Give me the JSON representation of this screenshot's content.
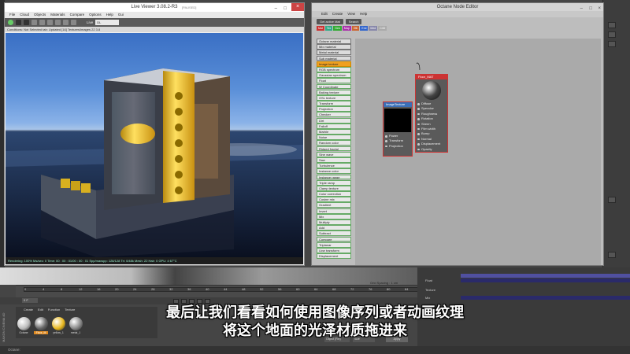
{
  "live_viewer": {
    "title": "Live Viewer 3.08.2-R3",
    "subtitle": "[PAUSED]",
    "menu": [
      "File",
      "Cloud",
      "Objects",
      "Materials",
      "Compare",
      "Options",
      "Help",
      "Gui"
    ],
    "toolbar_label": "Live",
    "toolbar_select": "DL",
    "status": "Conditions: Not Selected tab: Updated [16] Textures/images 22 3.8",
    "footer": "Rendering: 100%  Ms/sec: 0   Time: 00 : 00 : 01/00 : 00 : 01   Spp/maxspp: 128/128   Tri: 0/48k   Mesh: 22   Hair: 0   GPU: 4   67°C"
  },
  "node_editor": {
    "title": "Octane Node Editor",
    "menu": [
      "Edit",
      "Create",
      "View",
      "Help"
    ],
    "toolbar": [
      "Get active Mat",
      "Search"
    ],
    "tabs": [
      {
        "label": "Mat",
        "color": "#c33"
      },
      {
        "label": "Tex",
        "color": "#3a8"
      },
      {
        "label": "Gen",
        "color": "#3a3"
      },
      {
        "label": "Map",
        "color": "#a3a"
      },
      {
        "label": "Oth",
        "color": "#c63"
      },
      {
        "label": "Emi",
        "color": "#36c"
      },
      {
        "label": "Med",
        "color": "#88a"
      },
      {
        "label": "C4D",
        "color": "#aaa"
      }
    ],
    "node_list": [
      "Octane material",
      "Mix material",
      "Metal material",
      "Sub material",
      "Image texture",
      "RGB spectrum",
      "Gaussian spectrum",
      "Float",
      "W Coordinate",
      "Baking texture",
      "OSL texture",
      "Transform",
      "Projection",
      "Checker",
      "Dirt",
      "Falloff",
      "Marble",
      "Noise",
      "Random color",
      "Ridged fractal",
      "Sine wave",
      "Saw",
      "Turbulence",
      "Instance color",
      "Instance range",
      "Triple ramp",
      "Clamp texture",
      "Color correction",
      "Cosine mix",
      "Gradient",
      "Invert",
      "Mix",
      "Multiply",
      "Add",
      "Subtract",
      "Compare",
      "Triplanar",
      "Uvw transform",
      "Displacement"
    ],
    "selected_item": "Image texture",
    "image_node": {
      "title": "ImageTexture",
      "ports": [
        "Power",
        "Transform",
        "Projection"
      ]
    },
    "material_node": {
      "title": "Floor_MAT",
      "ports": [
        "Diffuse",
        "Specular",
        "Roughness",
        "Rotation",
        "Sheen",
        "Film width",
        "Bump",
        "Normal",
        "Displacement",
        "Opacity"
      ]
    }
  },
  "timeline": {
    "ticks": [
      "0",
      "4",
      "8",
      "12",
      "16",
      "20",
      "24",
      "28",
      "32",
      "36",
      "40",
      "44",
      "48",
      "52",
      "56",
      "60",
      "64",
      "68",
      "72",
      "76",
      "80",
      "84",
      "88"
    ],
    "frame_left": "0 F",
    "grid_spacing": "Grid Spacing : 1 cm"
  },
  "materials": {
    "menu": [
      "Create",
      "Edit",
      "Function",
      "Texture"
    ],
    "items": [
      {
        "label": "Octane",
        "color": "#bbb"
      },
      {
        "label": "Floor_M",
        "color": "#666"
      },
      {
        "label": "yellow_1",
        "color": "#e8b820"
      },
      {
        "label": "metal_1",
        "color": "#888"
      }
    ]
  },
  "attributes": {
    "rows": [
      "Float",
      "Texture",
      "Mix"
    ],
    "buttons": [
      "Object (Rel)",
      "Size",
      "Apply"
    ]
  },
  "status": "Octane:",
  "side_label": "MAXON CINEMA 4D",
  "subtitles": [
    "最后让我们看看如何使用图像序列或者动画纹理",
    "将这个地面的光泽材质拖进来"
  ]
}
